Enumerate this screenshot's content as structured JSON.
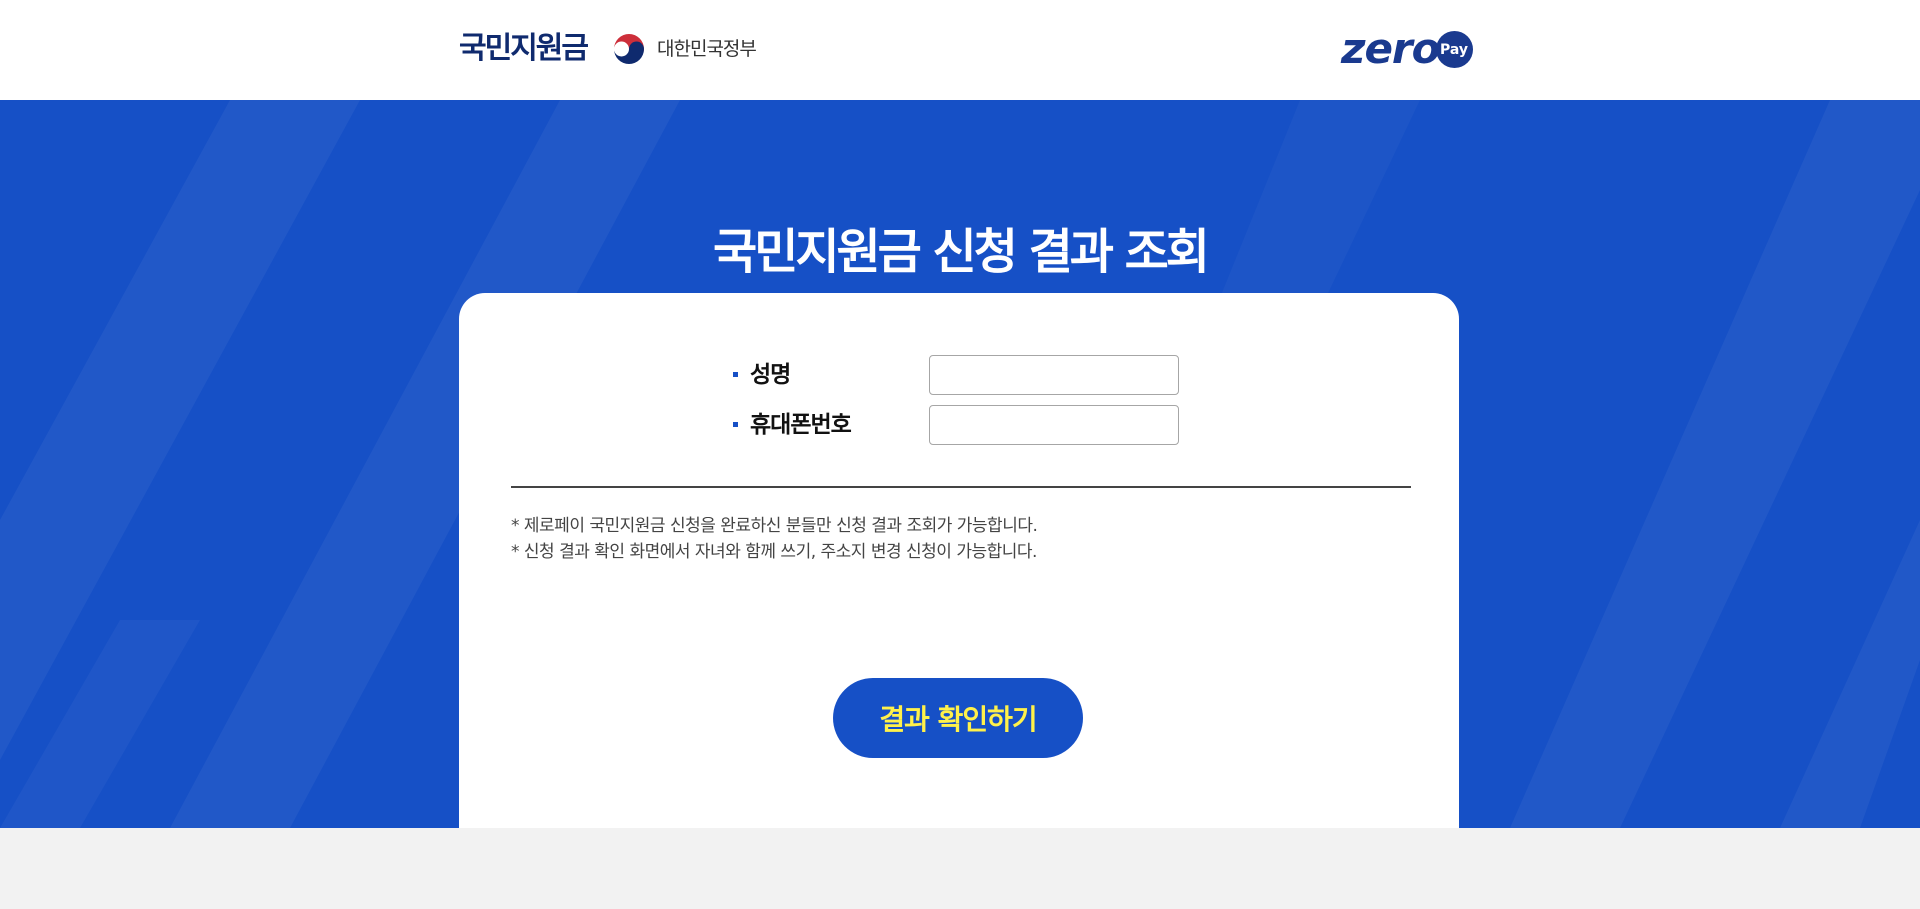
{
  "header": {
    "brand_text": "국민지원금",
    "gov_name": "대한민국정부",
    "zeropay_word": "zero",
    "zeropay_pay": "Pay"
  },
  "main": {
    "title": "국민지원금 신청 결과 조회",
    "form": {
      "name_label": "성명",
      "name_value": "",
      "phone_label": "휴대폰번호",
      "phone_value": ""
    },
    "notices": [
      "* 제로페이 국민지원금 신청을 완료하신 분들만 신청 결과 조회가 가능합니다.",
      "* 신청 결과 확인 화면에서 자녀와 함께 쓰기, 주소지 변경 신청이 가능합니다."
    ],
    "submit_label": "결과 확인하기"
  },
  "colors": {
    "hero_blue": "#1650c6",
    "brand_navy": "#0f2a6e",
    "button_text_yellow": "#fff14a",
    "page_gray": "#f2f2f2"
  },
  "icons": {
    "gov_emblem": "taegeuk-emblem-icon",
    "zeropay": "zeropay-logo"
  }
}
